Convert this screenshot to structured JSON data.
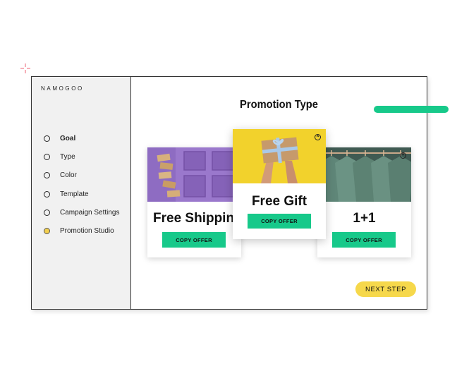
{
  "brand": {
    "logo": "NAMOGOO"
  },
  "decor": {
    "accent_green": "#17c98a",
    "accent_yellow": "#f6d84b",
    "sparkle_color": "#f07a8a"
  },
  "sidebar": {
    "steps": [
      {
        "label": "Goal",
        "state": "current"
      },
      {
        "label": "Type",
        "state": "incomplete"
      },
      {
        "label": "Color",
        "state": "incomplete"
      },
      {
        "label": "Template",
        "state": "incomplete"
      },
      {
        "label": "Campaign Settings",
        "state": "incomplete"
      },
      {
        "label": "Promotion Studio",
        "state": "active"
      }
    ]
  },
  "main": {
    "title": "Promotion Type",
    "cards": [
      {
        "title": "Free Shipping",
        "button": "COPY OFFER",
        "image": "purple door with cardboard boxes",
        "close_icon": "close-circle-icon"
      },
      {
        "title": "Free Gift",
        "button": "COPY OFFER",
        "image": "hands holding wrapped gift on yellow",
        "close_icon": "close-circle-icon"
      },
      {
        "title": "1+1",
        "button": "COPY OFFER",
        "image": "green shirts on hangers",
        "close_icon": "close-circle-icon"
      }
    ],
    "next_button": "NEXT STEP"
  }
}
